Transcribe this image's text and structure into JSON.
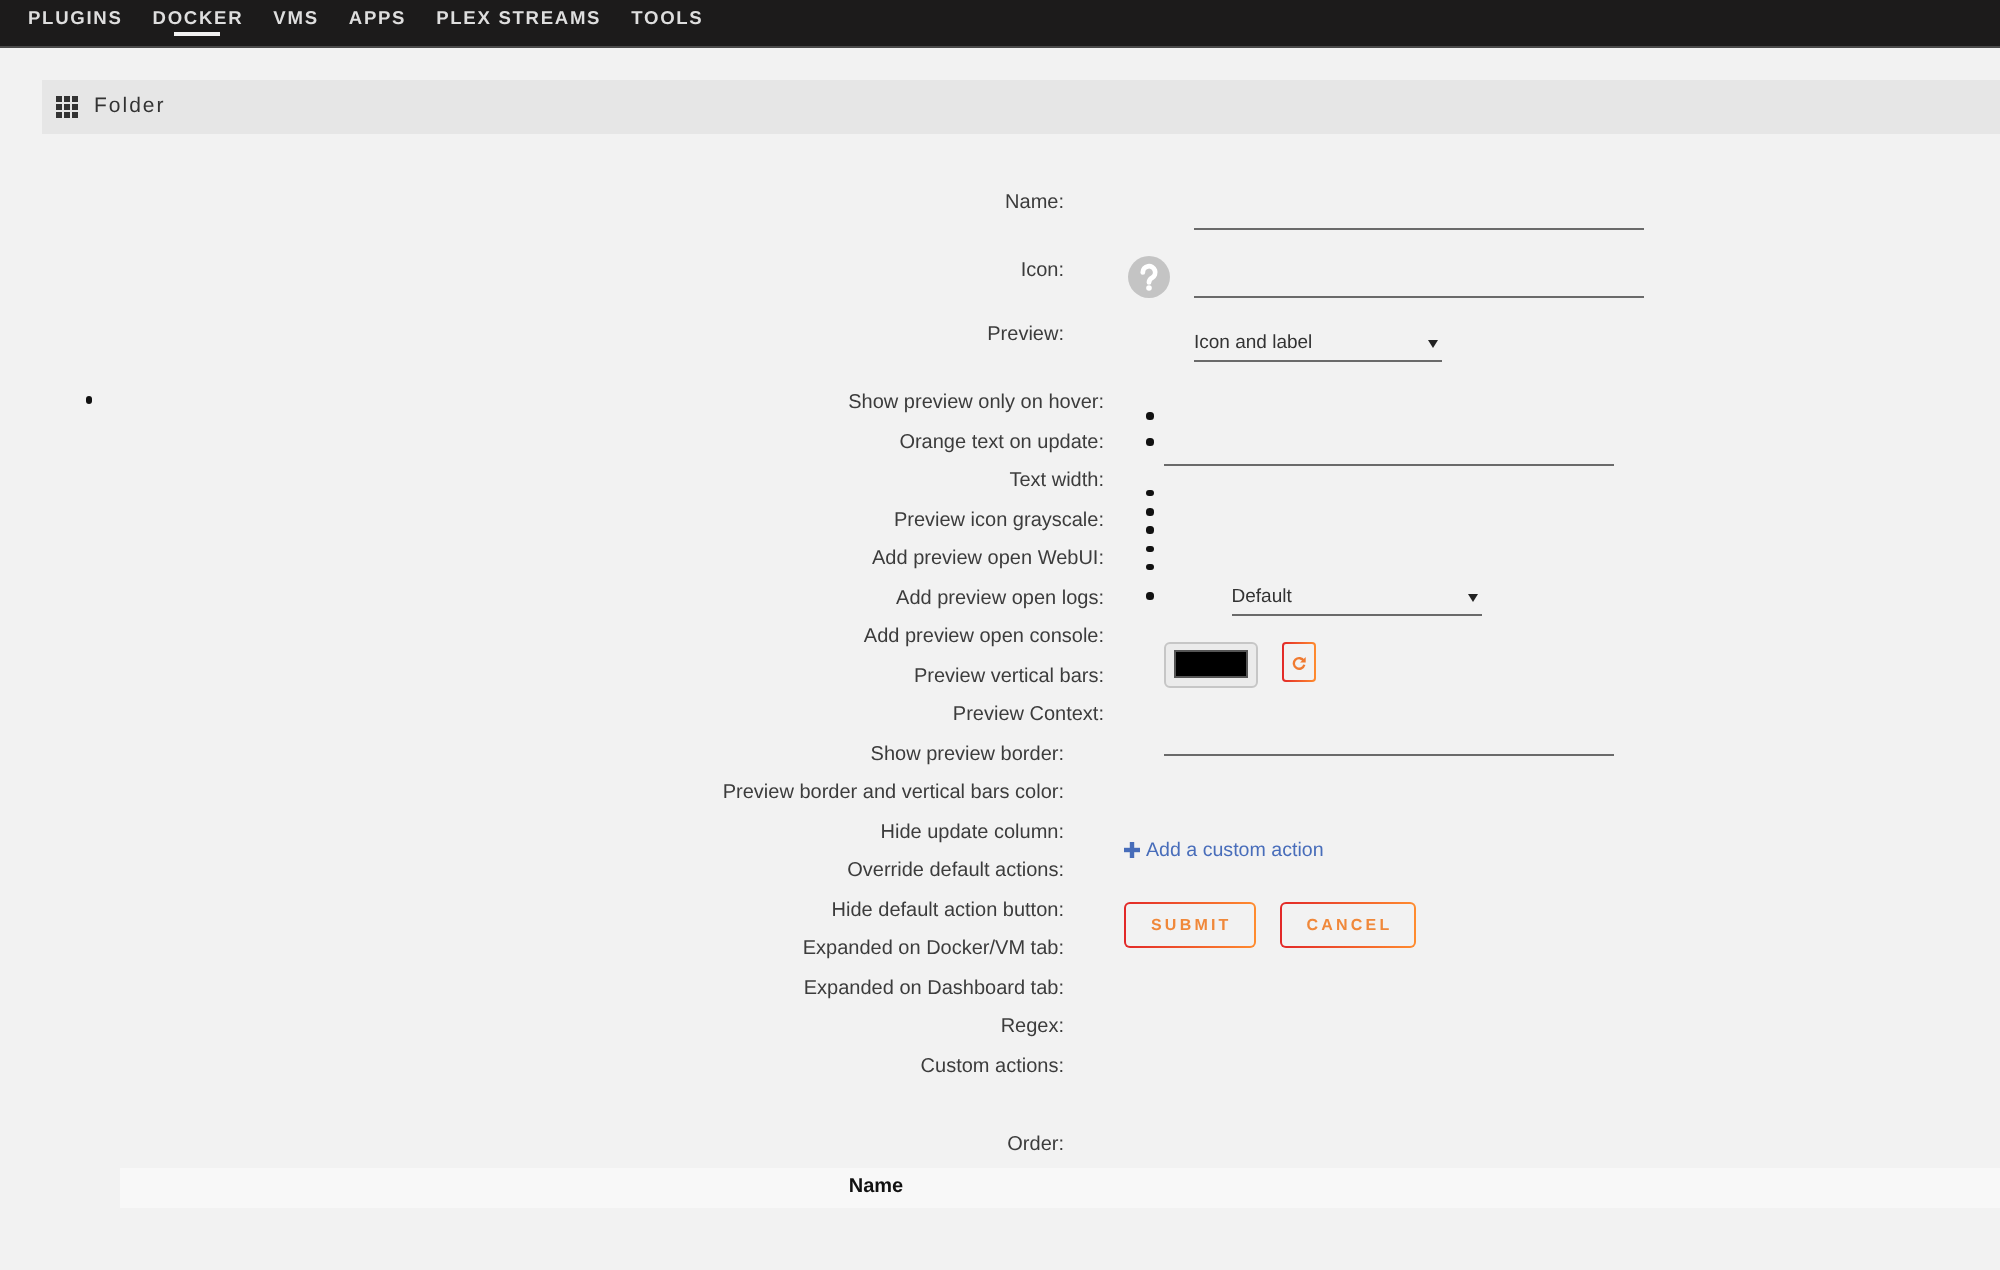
{
  "nav": {
    "items": [
      {
        "label": "PLUGINS",
        "selected": false
      },
      {
        "label": "DOCKER",
        "selected": true
      },
      {
        "label": "VMS",
        "selected": false
      },
      {
        "label": "APPS",
        "selected": false
      },
      {
        "label": "PLEX STREAMS",
        "selected": false
      },
      {
        "label": "TOOLS",
        "selected": false
      }
    ]
  },
  "header": {
    "title": "Folder"
  },
  "main_fields": [
    {
      "label": "Name:",
      "kind": "input"
    },
    {
      "label": "Icon:",
      "kind": "icon_input"
    },
    {
      "label": "Preview:",
      "kind": "select",
      "value": "Icon and label"
    }
  ],
  "preview_labels": [
    "Show preview only on hover:",
    "Orange text on update:",
    "Text width:",
    "Preview icon grayscale:",
    "Add preview open WebUI:",
    "Add preview open logs:",
    "Add preview open console:",
    "Preview vertical bars:",
    "Preview Context:"
  ],
  "option_labels": [
    "Show preview border:",
    "Preview border and vertical bars color:",
    "Hide update column:",
    "Override default actions:",
    "Hide default action button:",
    "Expanded on Docker/VM tab:",
    "Expanded on Dashboard tab:",
    "Regex:",
    "Custom actions:"
  ],
  "side_controls": [
    {
      "kind": "bullet"
    },
    {
      "kind": "bullet_input"
    },
    {
      "kind": "bullet"
    },
    {
      "kind": "bullet"
    },
    {
      "kind": "bullet"
    },
    {
      "kind": "bullet"
    },
    {
      "kind": "bullet"
    },
    {
      "kind": "bullet_select",
      "value": "Default"
    },
    {
      "kind": "color_picker"
    },
    {
      "kind": "input"
    }
  ],
  "custom_action_link": {
    "label": "Add a custom action"
  },
  "buttons": [
    {
      "label": "SUBMIT"
    },
    {
      "label": "CANCEL"
    }
  ],
  "order": {
    "label": "Order:"
  },
  "table": {
    "columns": [
      "Name"
    ]
  }
}
